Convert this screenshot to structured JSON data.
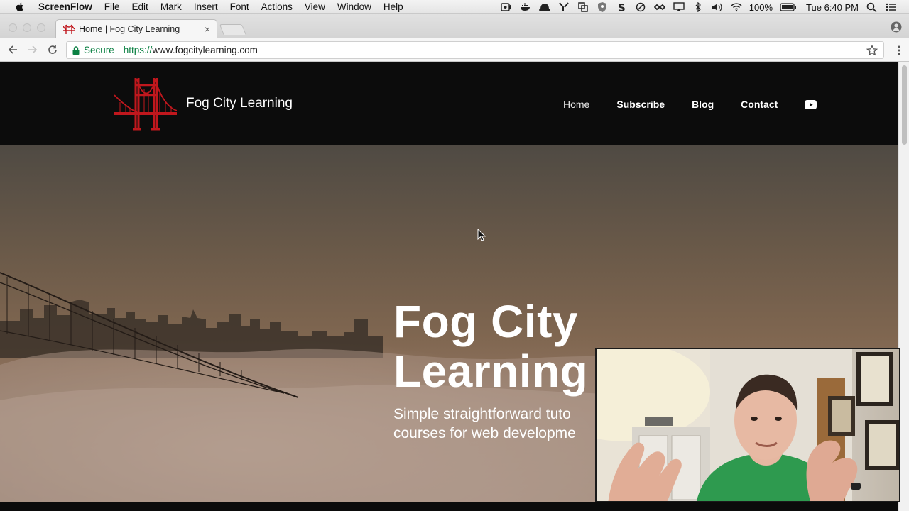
{
  "menubar": {
    "app_name": "ScreenFlow",
    "items": [
      "File",
      "Edit",
      "Mark",
      "Insert",
      "Font",
      "Actions",
      "View",
      "Window",
      "Help"
    ],
    "battery": "100%",
    "clock": "Tue 6:40 PM"
  },
  "browser": {
    "tab_title": "Home | Fog City Learning",
    "tab_close": "×",
    "secure_label": "Secure",
    "url_scheme": "https://",
    "url_host": "www.fogcitylearning.com"
  },
  "site": {
    "name": "Fog City Learning",
    "nav": [
      {
        "label": "Home",
        "active": true
      },
      {
        "label": "Subscribe"
      },
      {
        "label": "Blog"
      },
      {
        "label": "Contact"
      }
    ],
    "hero": {
      "title_line1": "Fog City",
      "title_line2": "Learning",
      "subtitle_line1": "Simple straightforward tuto",
      "subtitle_line2": "courses for web developme"
    }
  },
  "colors": {
    "header_bg": "#0c0c0c",
    "logo_red": "#c0171d",
    "secure_green": "#0b8043"
  }
}
